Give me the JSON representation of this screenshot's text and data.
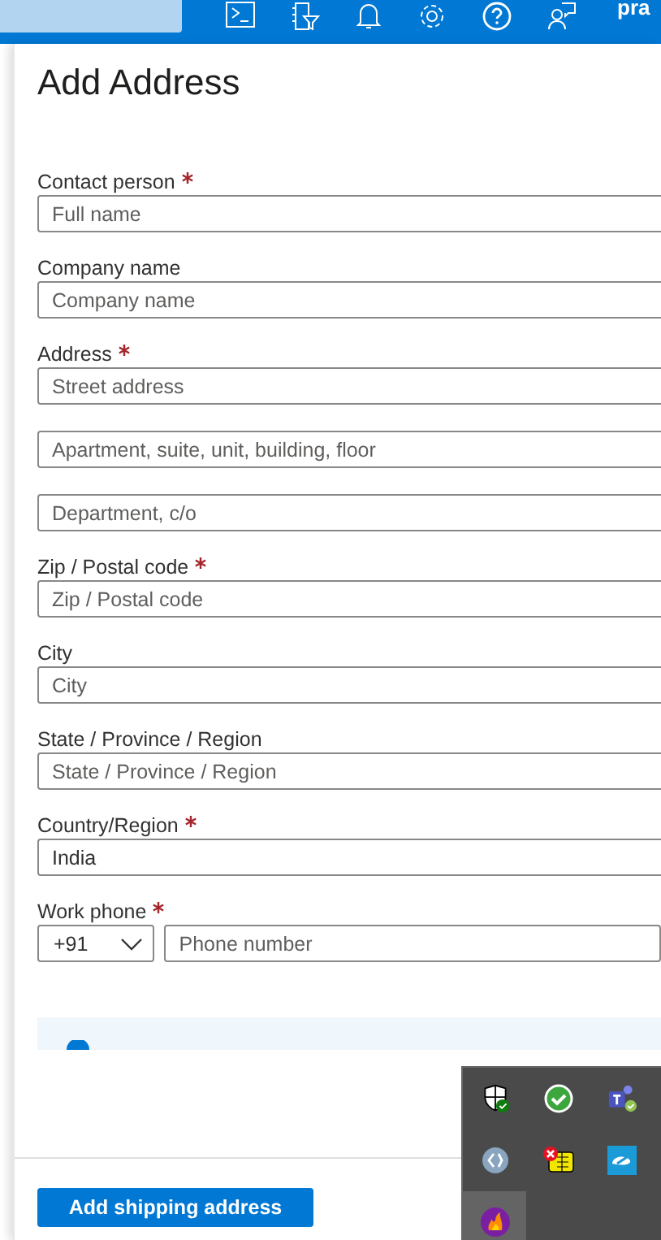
{
  "top_bar": {
    "user": "pra"
  },
  "title": "Add Address",
  "fields": [
    {
      "kind": "text",
      "label": "Contact person",
      "required": true,
      "inputs": [
        {
          "placeholder": "Full name"
        }
      ]
    },
    {
      "kind": "text",
      "label": "Company name",
      "required": false,
      "inputs": [
        {
          "placeholder": "Company name"
        }
      ]
    },
    {
      "kind": "text",
      "label": "Address",
      "required": true,
      "inputs": [
        {
          "placeholder": "Street address"
        },
        {
          "placeholder": "Apartment, suite, unit, building, floor"
        },
        {
          "placeholder": "Department, c/o"
        }
      ]
    },
    {
      "kind": "text",
      "label": "Zip / Postal code",
      "required": true,
      "inputs": [
        {
          "placeholder": "Zip / Postal code"
        }
      ]
    },
    {
      "kind": "text",
      "label": "City",
      "required": false,
      "inputs": [
        {
          "placeholder": "City"
        }
      ]
    },
    {
      "kind": "text",
      "label": "State / Province / Region",
      "required": false,
      "inputs": [
        {
          "placeholder": "State / Province / Region"
        }
      ]
    },
    {
      "kind": "text",
      "label": "Country/Region",
      "required": true,
      "inputs": [
        {
          "value": "India"
        }
      ]
    },
    {
      "kind": "phone",
      "label": "Work phone",
      "required": true,
      "code": "+91",
      "inputs": [
        {
          "placeholder": "Phone number"
        }
      ]
    }
  ],
  "footer": {
    "button": "Add shipping address"
  }
}
